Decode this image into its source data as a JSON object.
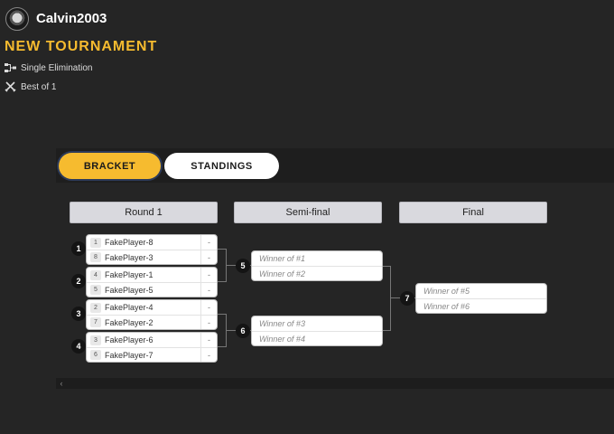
{
  "user": {
    "name": "Calvin2003"
  },
  "tournament": {
    "title": "NEW TOURNAMENT",
    "format": "Single Elimination",
    "series": "Best of 1"
  },
  "tabs": {
    "bracket": "BRACKET",
    "standings": "STANDINGS",
    "active": "bracket"
  },
  "rounds": [
    "Round 1",
    "Semi-final",
    "Final"
  ],
  "matches": {
    "m1": {
      "num": "1",
      "p1": {
        "seed": "1",
        "name": "FakePlayer-8",
        "score": "-"
      },
      "p2": {
        "seed": "8",
        "name": "FakePlayer-3",
        "score": "-"
      }
    },
    "m2": {
      "num": "2",
      "p1": {
        "seed": "4",
        "name": "FakePlayer-1",
        "score": "-"
      },
      "p2": {
        "seed": "5",
        "name": "FakePlayer-5",
        "score": "-"
      }
    },
    "m3": {
      "num": "3",
      "p1": {
        "seed": "2",
        "name": "FakePlayer-4",
        "score": "-"
      },
      "p2": {
        "seed": "7",
        "name": "FakePlayer-2",
        "score": "-"
      }
    },
    "m4": {
      "num": "4",
      "p1": {
        "seed": "3",
        "name": "FakePlayer-6",
        "score": "-"
      },
      "p2": {
        "seed": "6",
        "name": "FakePlayer-7",
        "score": "-"
      }
    },
    "m5": {
      "num": "5",
      "p1": "Winner of #1",
      "p2": "Winner of #2"
    },
    "m6": {
      "num": "6",
      "p1": "Winner of #3",
      "p2": "Winner of #4"
    },
    "m7": {
      "num": "7",
      "p1": "Winner of #5",
      "p2": "Winner of #6"
    }
  },
  "colors": {
    "accent": "#f6bb2f",
    "background": "#252525",
    "card": "#ffffff",
    "header_bg": "#d9d9de"
  },
  "icons": {
    "format": "bracket-tree-icon",
    "series": "crossed-swords-icon",
    "scroll": "chevron-left-icon"
  }
}
